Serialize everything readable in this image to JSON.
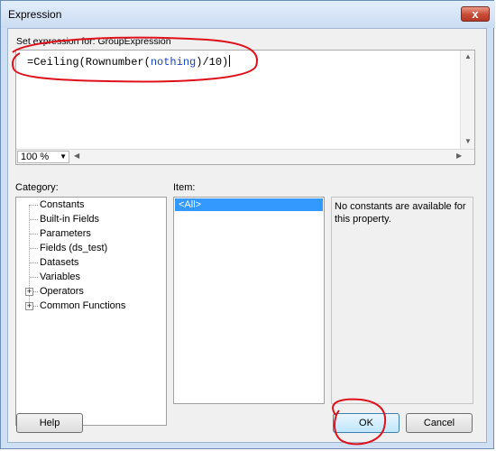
{
  "window": {
    "title": "Expression",
    "close_glyph": "x"
  },
  "expression": {
    "label": "Set expression for: GroupExpression",
    "code_prefix": "=Ceiling(Rownumber(",
    "code_keyword": "nothing",
    "code_suffix": ")/10)",
    "zoom": "100 %"
  },
  "category": {
    "label": "Category:",
    "items": [
      "Constants",
      "Built-in Fields",
      "Parameters",
      "Fields (ds_test)",
      "Datasets",
      "Variables",
      "Operators",
      "Common Functions"
    ],
    "selected": "Constants"
  },
  "item": {
    "label": "Item:",
    "items": [
      "<All>"
    ]
  },
  "description": "No constants are available for this property.",
  "buttons": {
    "help": "Help",
    "ok": "OK",
    "cancel": "Cancel"
  },
  "colors": {
    "selection": "#3399ff",
    "keyword": "#1a45c8",
    "annotation": "#e0101a"
  },
  "icons": [
    "close-icon",
    "scroll-up-arrow-icon",
    "scroll-down-arrow-icon",
    "scroll-left-arrow-icon",
    "scroll-right-arrow-icon",
    "dropdown-arrow-icon",
    "expand-plus-icon"
  ]
}
